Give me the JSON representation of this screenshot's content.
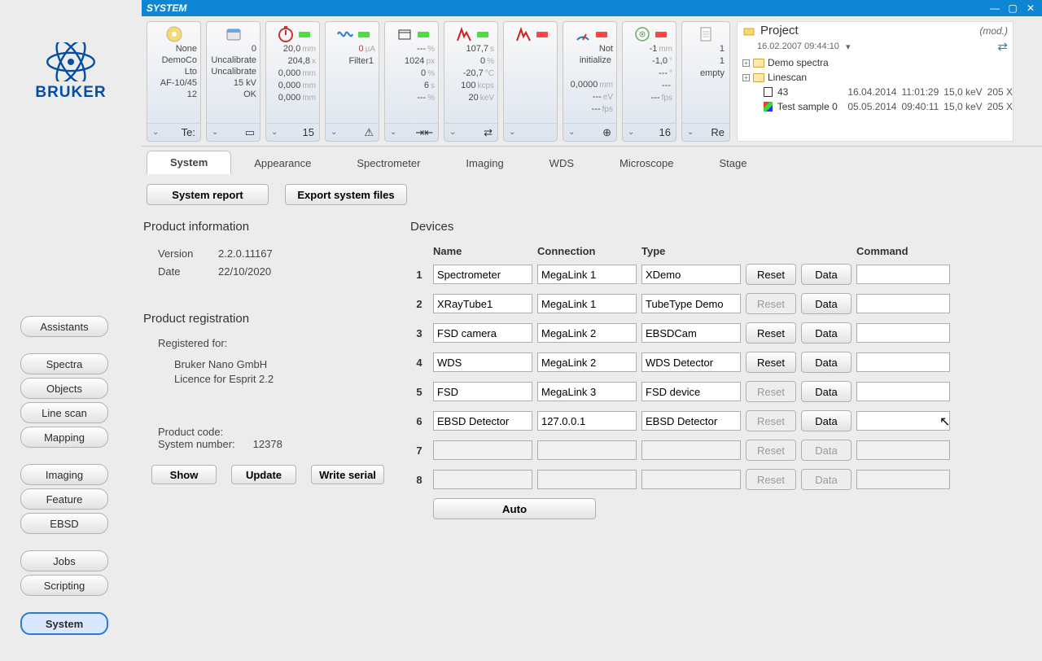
{
  "window_title": "SYSTEM",
  "brand": "BRUKER",
  "sidebar": {
    "groups": [
      [
        "Assistants"
      ],
      [
        "Spectra",
        "Objects",
        "Line scan",
        "Mapping"
      ],
      [
        "Imaging",
        "Feature",
        "EBSD"
      ],
      [
        "Jobs",
        "Scripting"
      ],
      [
        "System"
      ]
    ],
    "active": "System"
  },
  "ribbon": [
    {
      "icon": "disc",
      "badge": "",
      "lines": [
        "None",
        "DemoCo Lto",
        "AF-10/45",
        "12"
      ],
      "foot": "Te:"
    },
    {
      "icon": "cal",
      "badge": "",
      "lines": [
        "0",
        "Uncalibrate",
        "Uncalibrate",
        "15 kV",
        "OK"
      ],
      "foot": "▭"
    },
    {
      "icon": "timer",
      "badge": "g",
      "lines": [
        {
          "v": "20,0",
          "u": "mm"
        },
        {
          "v": "204,8",
          "u": "x"
        },
        {
          "v": "0,000",
          "u": "mm"
        },
        {
          "v": "0,000",
          "u": "mm"
        },
        {
          "v": "0,000",
          "u": "mm"
        }
      ],
      "foot": "15"
    },
    {
      "icon": "wave",
      "badge": "g",
      "lines": [
        {
          "v": "0",
          "u": "µA",
          "red": true
        },
        {
          "v": "Filter1",
          "u": ""
        }
      ],
      "foot": "⚠",
      "foot_icon": "radiation"
    },
    {
      "icon": "box",
      "badge": "g",
      "lines": [
        {
          "v": "---",
          "u": "%"
        },
        {
          "v": "1024",
          "u": "px"
        },
        {
          "v": "0",
          "u": "%"
        },
        {
          "v": "6",
          "u": "s"
        },
        {
          "v": "---",
          "u": "%"
        }
      ],
      "foot": "⇥⇤"
    },
    {
      "icon": "peak",
      "badge": "g",
      "lines": [
        {
          "v": "107,7",
          "u": "s"
        },
        {
          "v": "0",
          "u": "%"
        },
        {
          "v": "-20,7",
          "u": "°C"
        },
        {
          "v": "100",
          "u": "kcps"
        },
        {
          "v": "20",
          "u": "keV"
        }
      ],
      "foot": "⇄"
    },
    {
      "icon": "peak2",
      "badge": "r",
      "lines": [],
      "foot": ""
    },
    {
      "icon": "gauge",
      "badge": "r",
      "lines": [
        {
          "v": "Not initialize",
          "u": ""
        },
        {
          "v": "",
          "u": ""
        },
        {
          "v": "0,0000",
          "u": "mm"
        },
        {
          "v": "---",
          "u": "eV"
        },
        {
          "v": "---",
          "u": "fps"
        }
      ],
      "foot": "⊕"
    },
    {
      "icon": "target",
      "badge": "r",
      "lines": [
        {
          "v": "-1",
          "u": "mm"
        },
        {
          "v": "-1,0",
          "u": "°"
        },
        {
          "v": "---",
          "u": "°"
        },
        {
          "v": "---",
          "u": ""
        },
        {
          "v": "---",
          "u": "fps"
        }
      ],
      "foot": "16"
    },
    {
      "icon": "doc",
      "badge": "",
      "lines": [
        {
          "v": "1",
          "u": ""
        },
        {
          "v": "1",
          "u": ""
        },
        {
          "v": "empty",
          "u": ""
        }
      ],
      "foot": "Re",
      "narrow": true
    }
  ],
  "project": {
    "title": "Project",
    "mod": "(mod.)",
    "timestamp": "16.02.2007 09:44:10",
    "folders": [
      "Demo spectra",
      "Linescan"
    ],
    "items": [
      {
        "sw": "bw",
        "name": "43",
        "date": "16.04.2014",
        "time": "11:01:29",
        "e": "15,0 keV",
        "px": "205 X"
      },
      {
        "sw": "rgb",
        "name": "Test sample 0",
        "date": "05.05.2014",
        "time": "09:40:11",
        "e": "15,0 keV",
        "px": "205 X"
      }
    ]
  },
  "tabs": [
    "System",
    "Appearance",
    "Spectrometer",
    "Imaging",
    "WDS",
    "Microscope",
    "Stage"
  ],
  "active_tab": "System",
  "buttons": {
    "system_report": "System report",
    "export": "Export system files"
  },
  "product_info": {
    "heading": "Product information",
    "version_k": "Version",
    "version_v": "2.2.0.11167",
    "date_k": "Date",
    "date_v": "22/10/2020"
  },
  "registration": {
    "heading": "Product registration",
    "registered_for": "Registered for:",
    "lines": [
      "Bruker Nano GmbH",
      "Licence for Esprit 2.2"
    ],
    "product_code_k": "Product code:",
    "system_number_k": "System number:",
    "system_number_v": "12378",
    "btn_show": "Show",
    "btn_update": "Update",
    "btn_write": "Write serial"
  },
  "devices": {
    "heading": "Devices",
    "columns": {
      "name": "Name",
      "connection": "Connection",
      "type": "Type",
      "command": "Command"
    },
    "reset_label": "Reset",
    "data_label": "Data",
    "auto_label": "Auto",
    "rows": [
      {
        "n": 1,
        "name": "Spectrometer",
        "conn": "MegaLink 1",
        "type": "XDemo",
        "reset": true,
        "data": true
      },
      {
        "n": 2,
        "name": "XRayTube1",
        "conn": "MegaLink 1",
        "type": "TubeType Demo",
        "reset": false,
        "data": true
      },
      {
        "n": 3,
        "name": "FSD camera",
        "conn": "MegaLink 2",
        "type": "EBSDCam",
        "reset": true,
        "data": true
      },
      {
        "n": 4,
        "name": "WDS",
        "conn": "MegaLink 2",
        "type": "WDS Detector",
        "reset": true,
        "data": true
      },
      {
        "n": 5,
        "name": "FSD",
        "conn": "MegaLink 3",
        "type": "FSD device",
        "reset": false,
        "data": true
      },
      {
        "n": 6,
        "name": "EBSD Detector",
        "conn": "127.0.0.1",
        "type": "EBSD Detector",
        "reset": false,
        "data": true
      },
      {
        "n": 7,
        "name": "",
        "conn": "",
        "type": "",
        "reset": false,
        "data": false
      },
      {
        "n": 8,
        "name": "",
        "conn": "",
        "type": "",
        "reset": false,
        "data": false
      }
    ]
  }
}
